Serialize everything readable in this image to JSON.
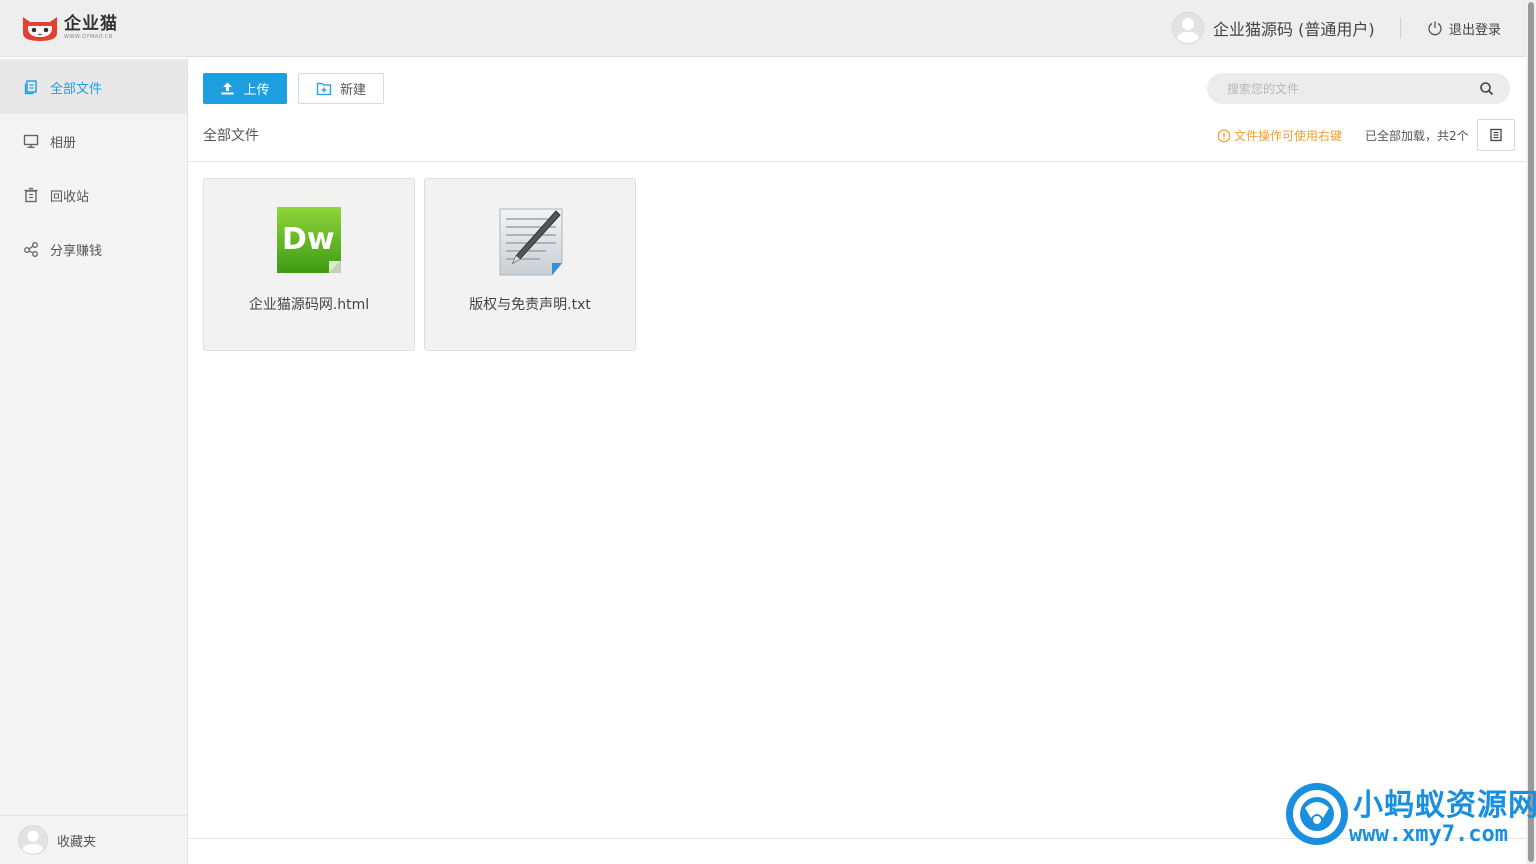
{
  "header": {
    "logo_title": "企业猫",
    "logo_sub": "WWW.QYMAO.CN",
    "user_name": "企业猫源码 (普通用户)",
    "logout_label": "退出登录"
  },
  "sidebar": {
    "items": [
      {
        "label": "全部文件",
        "icon": "files-icon",
        "active": true
      },
      {
        "label": "相册",
        "icon": "monitor-icon",
        "active": false
      },
      {
        "label": "回收站",
        "icon": "trash-icon",
        "active": false
      },
      {
        "label": "分享赚钱",
        "icon": "share-icon",
        "active": false
      }
    ],
    "footer_label": "收藏夹"
  },
  "toolbar": {
    "upload_label": "上传",
    "new_label": "新建",
    "search_placeholder": "搜索您的文件"
  },
  "breadcrumb": "全部文件",
  "hint": "文件操作可使用右键",
  "count_text": "已全部加载，共2个",
  "files": [
    {
      "name": "企业猫源码网.html",
      "icon": "dreamweaver-html-icon"
    },
    {
      "name": "版权与免责声明.txt",
      "icon": "text-document-icon"
    }
  ],
  "watermark": {
    "title": "小蚂蚁资源网",
    "url": "www.xmy7.com"
  },
  "colors": {
    "accent": "#1e9fe0",
    "hint": "#f0a030",
    "header_bg": "#eeeeee",
    "sidebar_bg": "#f4f4f4",
    "watermark": "#1a8fe0"
  }
}
